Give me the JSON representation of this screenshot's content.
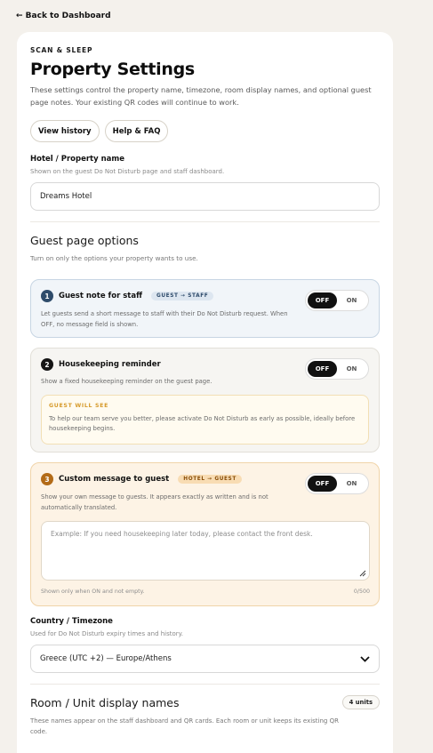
{
  "nav": {
    "back_label": "← Back to Dashboard"
  },
  "header": {
    "eyebrow": "SCAN & SLEEP",
    "title": "Property Settings",
    "intro": "These settings control the property name, timezone, room display names, and optional guest page notes. Your existing QR codes will continue to work.",
    "buttons": {
      "history": "View history",
      "help": "Help & FAQ"
    }
  },
  "property": {
    "label": "Hotel / Property name",
    "help": "Shown on the guest Do Not Disturb page and staff dashboard.",
    "value": "Dreams Hotel"
  },
  "guest_options": {
    "title": "Guest page options",
    "help": "Turn on only the options your property wants to use.",
    "toggle_off": "OFF",
    "toggle_on": "ON",
    "items": [
      {
        "number": "1",
        "title": "Guest note for staff",
        "tag": "GUEST → STAFF",
        "desc": "Let guests send a short message to staff with their Do Not Disturb request. When OFF, no message field is shown.",
        "state": "OFF"
      },
      {
        "number": "2",
        "title": "Housekeeping reminder",
        "desc": "Show a fixed housekeeping reminder on the guest page.",
        "state": "OFF",
        "preview_title": "GUEST WILL SEE",
        "preview_text": "To help our team serve you better, please activate Do Not Disturb as early as possible, ideally before housekeeping begins."
      },
      {
        "number": "3",
        "title": "Custom message to guest",
        "tag": "HOTEL → GUEST",
        "desc": "Show your own message to guests. It appears exactly as written and is not automatically translated.",
        "state": "OFF",
        "placeholder": "Example: If you need housekeeping later today, please contact the front desk.",
        "note": "Shown only when ON and not empty.",
        "counter": "0/500"
      }
    ]
  },
  "timezone": {
    "label": "Country / Timezone",
    "help": "Used for Do Not Disturb expiry times and history.",
    "value": "Greece (UTC +2) — Europe/Athens"
  },
  "rooms": {
    "title": "Room / Unit display names",
    "badge": "4 units",
    "help": "These names appear on the staff dashboard and QR cards. Each room or unit keeps its existing QR code."
  },
  "colors": {
    "page_bg": "#f4f1ec",
    "option1_bg": "#f1f5f9",
    "option3_bg": "#fdf3e5",
    "accent_orange": "#d69a2a",
    "toggle_active": "#111111"
  }
}
